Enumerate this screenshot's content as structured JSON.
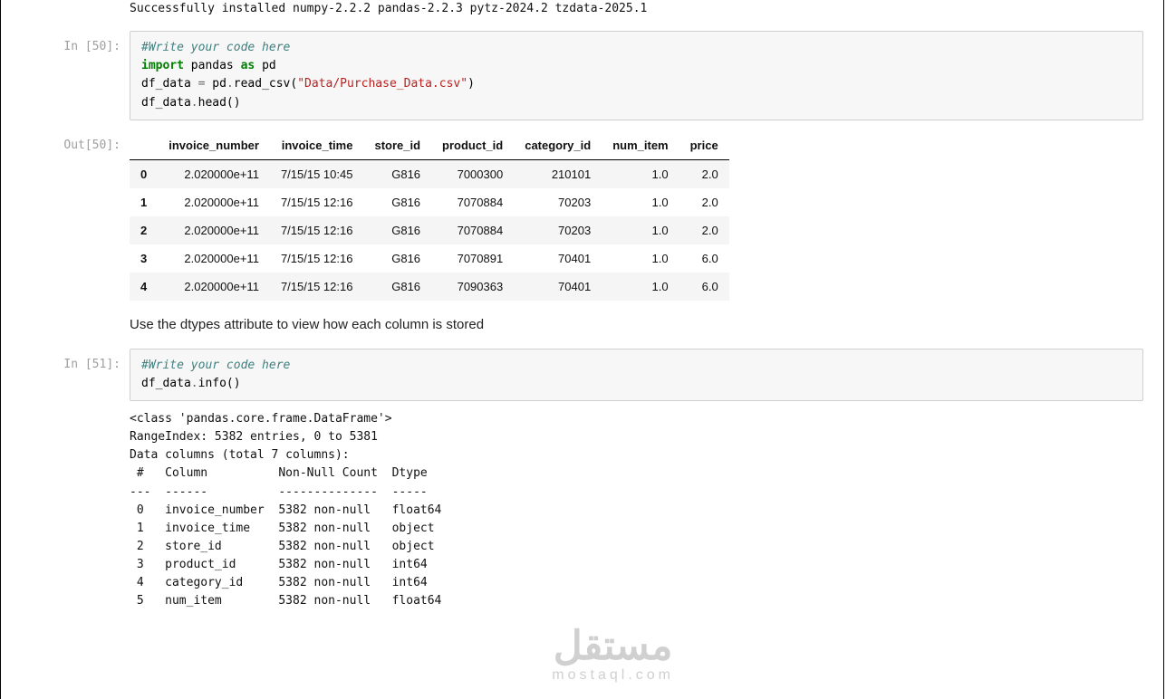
{
  "install_line": "Successfully installed numpy-2.2.2 pandas-2.2.3 pytz-2024.2 tzdata-2025.1",
  "prompts": {
    "in50": "In [50]:",
    "out50": "Out[50]:",
    "in51": "In [51]:"
  },
  "cell50": {
    "comment": "#Write your code here",
    "kw_import": "import",
    "mod": " pandas ",
    "kw_as": "as",
    "alias": " pd",
    "assign_left": "df_data ",
    "eq": "=",
    "assign_right_pre": " pd",
    "dot1": ".",
    "read_csv": "read_csv(",
    "path": "\"Data/Purchase_Data.csv\"",
    "close_paren": ")",
    "head_left": "df_data",
    "dot2": ".",
    "head_call": "head()"
  },
  "table": {
    "headers": [
      "invoice_number",
      "invoice_time",
      "store_id",
      "product_id",
      "category_id",
      "num_item",
      "price"
    ],
    "index": [
      "0",
      "1",
      "2",
      "3",
      "4"
    ],
    "rows": [
      [
        "2.020000e+11",
        "7/15/15 10:45",
        "G816",
        "7000300",
        "210101",
        "1.0",
        "2.0"
      ],
      [
        "2.020000e+11",
        "7/15/15 12:16",
        "G816",
        "7070884",
        "70203",
        "1.0",
        "2.0"
      ],
      [
        "2.020000e+11",
        "7/15/15 12:16",
        "G816",
        "7070884",
        "70203",
        "1.0",
        "2.0"
      ],
      [
        "2.020000e+11",
        "7/15/15 12:16",
        "G816",
        "7070891",
        "70401",
        "1.0",
        "6.0"
      ],
      [
        "2.020000e+11",
        "7/15/15 12:16",
        "G816",
        "7090363",
        "70401",
        "1.0",
        "6.0"
      ]
    ]
  },
  "paragraph": "Use the dtypes attribute to view how each column is stored",
  "cell51": {
    "comment": "#Write your code here",
    "left": "df_data",
    "dot": ".",
    "call": "info()"
  },
  "info_output": "<class 'pandas.core.frame.DataFrame'>\nRangeIndex: 5382 entries, 0 to 5381\nData columns (total 7 columns):\n #   Column          Non-Null Count  Dtype  \n---  ------          --------------  -----  \n 0   invoice_number  5382 non-null   float64\n 1   invoice_time    5382 non-null   object \n 2   store_id        5382 non-null   object \n 3   product_id      5382 non-null   int64  \n 4   category_id     5382 non-null   int64  \n 5   num_item        5382 non-null   float64",
  "watermark": {
    "arabic": "مستقل",
    "latin": "mostaql.com"
  }
}
